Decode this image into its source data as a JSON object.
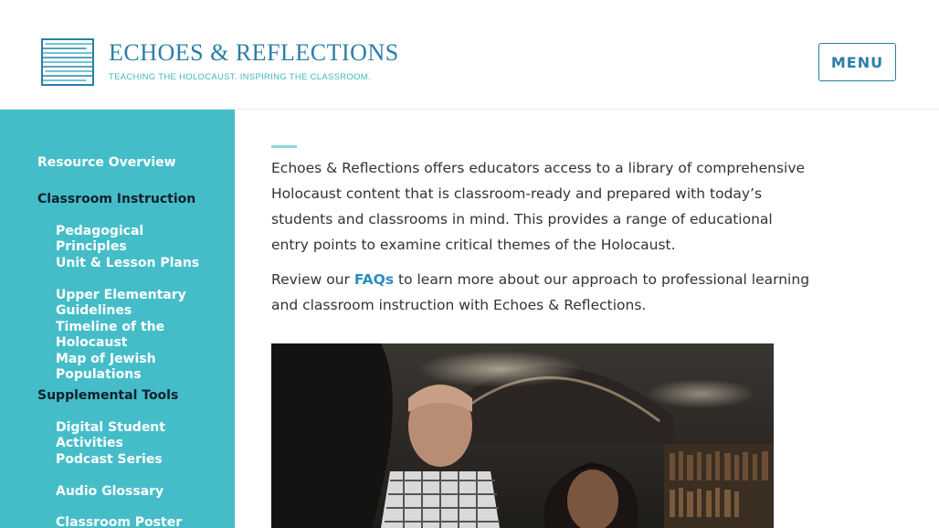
{
  "header": {
    "logo_title": "ECHOES & REFLECTIONS",
    "logo_tagline": "TEACHING THE HOLOCAUST. INSPIRING THE CLASSROOM.",
    "menu_label": "MENU"
  },
  "sidebar": {
    "resource_overview": "Resource Overview",
    "classroom_instruction": "Classroom Instruction",
    "classroom_items": [
      "Pedagogical Principles",
      "Unit & Lesson Plans",
      "Upper Elementary Guidelines",
      "Timeline of the Holocaust",
      "Map of Jewish Populations"
    ],
    "supplemental_tools": "Supplemental Tools",
    "supplemental_items": [
      "Digital Student Activities",
      "Podcast Series",
      "Audio Glossary",
      "Classroom Poster"
    ]
  },
  "main": {
    "intro": "Echoes & Reflections offers educators access to a library of comprehensive Holocaust content that is classroom-ready and prepared with today’s students and classrooms in mind. This provides a range of educational entry points to examine critical themes of the Holocaust.",
    "review_prefix": "Review our ",
    "faq_link": "FAQs",
    "review_suffix": " to learn more about our approach to professional learning and classroom instruction with Echoes & Reflections."
  },
  "colors": {
    "brand_blue": "#2a7fa6",
    "teal": "#45bdc9",
    "link": "#2a8ec0"
  }
}
